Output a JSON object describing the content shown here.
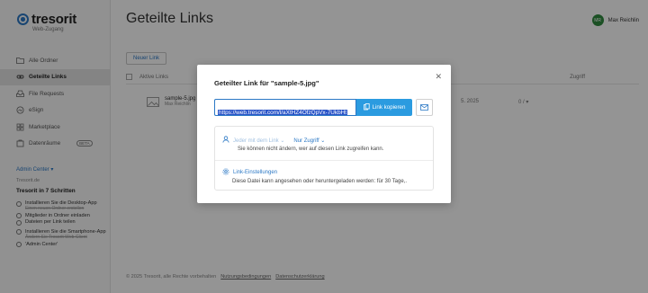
{
  "app": {
    "logo_text": "tresorit",
    "logo_subtitle": "Web-Zugang"
  },
  "sidebar": {
    "items": [
      {
        "label": "Alle Ordner",
        "icon": "folder-icon"
      },
      {
        "label": "Geteilte Links",
        "icon": "link-icon",
        "active": true
      },
      {
        "label": "File Requests",
        "icon": "inbox-icon"
      },
      {
        "label": "eSign",
        "icon": "signature-icon"
      },
      {
        "label": "Marketplace",
        "icon": "grid-icon"
      },
      {
        "label": "Datenräume",
        "icon": "rooms-icon",
        "badge": "BETA"
      }
    ],
    "admin_center": "Admin Center ▾",
    "org": "Tresorit.de",
    "steps_title": "Tresorit in 7 Schritten",
    "steps": [
      {
        "label": "Installieren Sie die Desktop-App",
        "sub": "Einen neuen Ordner erstellen"
      },
      {
        "label": "Mitglieder in Ordner einladen",
        "sub": ""
      },
      {
        "label": "Dateien per Link teilen",
        "sub": ""
      },
      {
        "label": "Installieren Sie die Smartphone-App",
        "sub": "Ändern Sie Tresorit Web-Client"
      },
      {
        "label": "'Admin Center'",
        "sub": ""
      }
    ]
  },
  "header": {
    "title": "Geteilte Links",
    "user_initials": "MR",
    "user_name": "Max Reichlin"
  },
  "main": {
    "new_link_label": "Neuer Link",
    "columns": {
      "name": "Aktive Links",
      "access": "Zugriff"
    },
    "rows": [
      {
        "name": "sample-5.jpg",
        "sub": "Max Reichlin",
        "date": "5. 2025",
        "access": "0 / ▾"
      }
    ]
  },
  "footer": {
    "copyright": "© 2025 Tresorit, alle Rechte vorbehalten",
    "terms": "Nutzungsbedingungen",
    "privacy": "Datenschutzerklärung"
  },
  "modal": {
    "title": "Geteilter Link für \"sample-5.jpg\"",
    "link": "https://web.tresorit.com/l/aXtHZ4OfzQpVx-7UkbHt",
    "copy_label": "Link kopieren",
    "perm_who": "Jeder mit dem Link",
    "perm_access": "Nur Zugriff",
    "perm_note": "Sie können nicht ändern, wer auf diesen Link zugreifen kann.",
    "settings_label": "Link-Einstellungen",
    "settings_note": "Diese Datei kann angesehen oder heruntergeladen werden: für 30 Tage,."
  },
  "colors": {
    "accent": "#2b78c5",
    "copy_button": "#2b9be0",
    "avatar": "#2f8a3e"
  }
}
